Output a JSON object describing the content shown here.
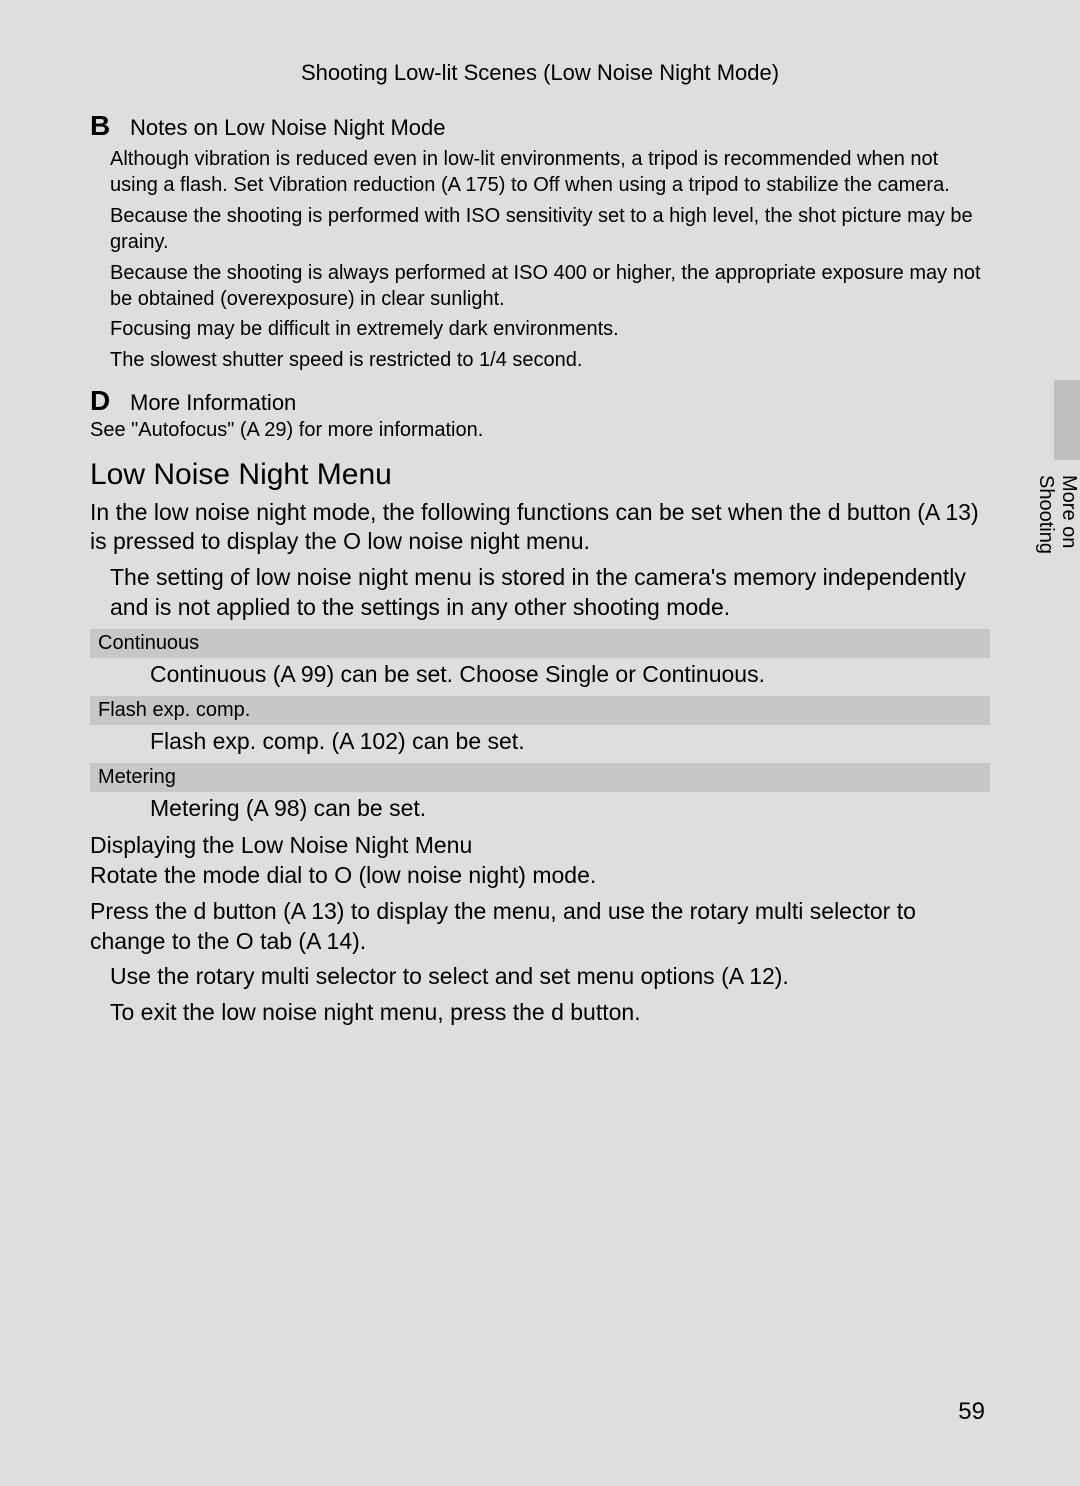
{
  "header": {
    "title": "Shooting Low-lit Scenes (Low Noise Night Mode)"
  },
  "notes_section": {
    "icon": "B",
    "heading": "Notes on Low Noise Night Mode",
    "bullet1": "Although vibration is reduced even in low-lit environments, a tripod is recommended when not using a flash. Set Vibration reduction (A 175) to Off when using a tripod to stabilize the camera.",
    "bullet2": "Because the shooting is performed with ISO sensitivity set to a high level, the shot picture may be grainy.",
    "bullet3": "Because the shooting is always performed at ISO 400 or higher, the appropriate exposure may not be obtained (overexposure) in clear sunlight.",
    "bullet4": "Focusing may be difficult in extremely dark environments.",
    "bullet5": "The slowest shutter speed is restricted to 1/4 second."
  },
  "moreinfo_section": {
    "icon": "D",
    "heading": "More Information",
    "text": "See \"Autofocus\" (A 29) for more information."
  },
  "menu_section": {
    "title": "Low Noise Night Menu",
    "intro": "In the low noise night mode, the following functions can be set when the d button (A 13) is pressed to display the O low noise night menu.",
    "note": "The setting of low noise night menu is stored in the camera's memory independently and is not applied to the settings in any other shooting mode.",
    "items": [
      {
        "label": "Continuous",
        "desc": "Continuous (A 99) can be set. Choose Single or Continuous."
      },
      {
        "label": "Flash exp. comp.",
        "desc": "Flash exp. comp. (A 102) can be set."
      },
      {
        "label": "Metering",
        "desc": "Metering (A 98) can be set."
      }
    ],
    "display_heading": "Displaying the Low Noise Night Menu",
    "display_line1": "Rotate the mode dial to O (low noise night) mode.",
    "display_line2": "Press the d button (A 13) to display the menu, and use the rotary multi selector to change to the O tab (A 14).",
    "display_bullet1": "Use the rotary multi selector to select and set menu options (A 12).",
    "display_bullet2": "To exit the low noise night menu, press the d button."
  },
  "side_tab_label": "More on Shooting",
  "page_number": "59"
}
